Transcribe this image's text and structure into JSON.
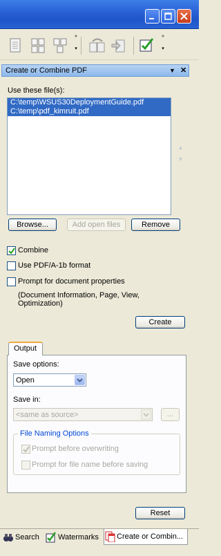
{
  "toolbar": {
    "icons": [
      "layout-single-icon",
      "layout-grid-icon",
      "layout-split-icon",
      "overflow-chevron-icon",
      "combine-pdf-icon",
      "import-pdf-icon",
      "checkbox-tool-icon",
      "overflow-chevron-icon"
    ]
  },
  "panel": {
    "title": "Create or Combine PDF",
    "dropdown_glyph": "▼",
    "close_glyph": "✕"
  },
  "files": {
    "label": "Use these file(s):",
    "items": [
      "C:\\temp\\WSUS30DeploymentGuide.pdf",
      "C:\\temp\\pdf_kimruit.pdf"
    ]
  },
  "buttons": {
    "browse": "Browse...",
    "add_open_files": "Add open files",
    "remove": "Remove",
    "create": "Create",
    "reset": "Reset"
  },
  "options": {
    "combine": {
      "label": "Combine",
      "checked": true
    },
    "pdfa": {
      "label": "Use PDF/A-1b format",
      "checked": false
    },
    "prompt_props": {
      "label": "Prompt for document properties",
      "checked": false
    },
    "props_note_line1": "(Document Information, Page, View,",
    "props_note_line2": "Optimization)"
  },
  "output": {
    "tab_label": "Output",
    "save_options_label": "Save options:",
    "save_options_value": "Open",
    "save_in_label": "Save in:",
    "save_in_value": "<same as source>",
    "browse_dots": "...",
    "naming_group_title": "File Naming Options",
    "prompt_overwrite": {
      "label": "Prompt before overwriting",
      "checked": true
    },
    "prompt_filename": {
      "label": "Prompt for file name before saving",
      "checked": false
    }
  },
  "bottom_tabs": [
    "Search",
    "Watermarks",
    "Create or Combin..."
  ],
  "colors": {
    "selection": "#316ac5",
    "titlebar": "#2a63d6",
    "group_title": "#0046d5",
    "tab_accent": "#f1a93e"
  }
}
